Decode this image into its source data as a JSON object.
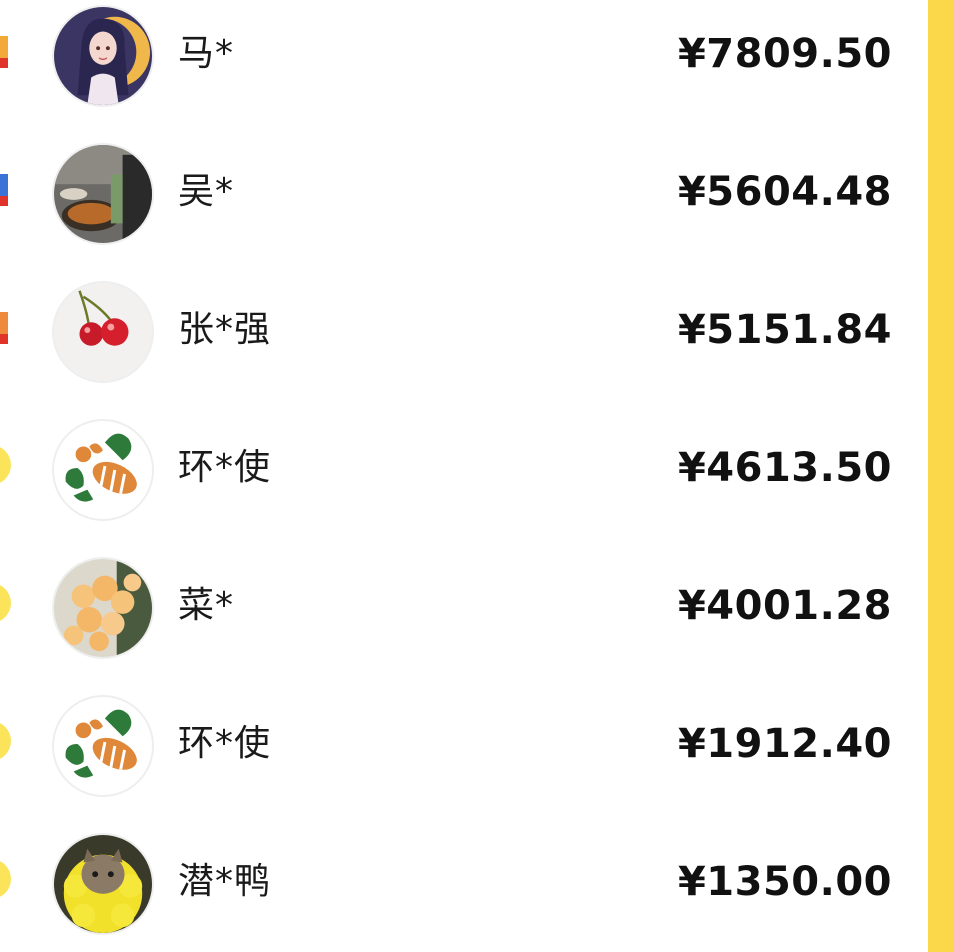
{
  "ranking": [
    {
      "name": "马*",
      "amount": "¥7809.50",
      "badge": "medal-gold-icon",
      "avatar": "anime-girl-avatar"
    },
    {
      "name": "吴*",
      "amount": "¥5604.48",
      "badge": "medal-blue-icon",
      "avatar": "cooking-photo-avatar"
    },
    {
      "name": "张*强",
      "amount": "¥5151.84",
      "badge": "medal-orange-icon",
      "avatar": "cherries-avatar"
    },
    {
      "name": "环*使",
      "amount": "¥4613.50",
      "badge": "rank-circle-icon",
      "avatar": "bee-logo-avatar"
    },
    {
      "name": "菜*",
      "amount": "¥4001.28",
      "badge": "rank-circle-icon",
      "avatar": "roses-avatar"
    },
    {
      "name": "环*使",
      "amount": "¥1912.40",
      "badge": "rank-circle-icon",
      "avatar": "bee-logo-avatar"
    },
    {
      "name": "潜*鸭",
      "amount": "¥1350.00",
      "badge": "rank-circle-icon",
      "avatar": "cat-flower-avatar"
    }
  ],
  "colors": {
    "accent_strip": "#fbd84a",
    "text": "#1a1a1a",
    "rank_circle": "#fbe35a"
  }
}
